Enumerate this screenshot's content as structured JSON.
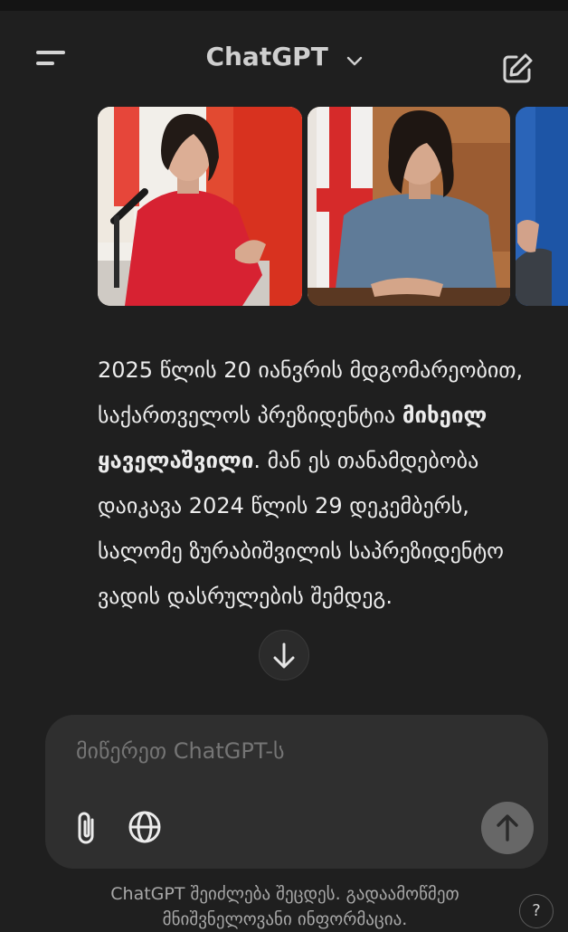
{
  "header": {
    "title": "ChatGPT",
    "menu_icon": "menu-icon",
    "model_chevron_icon": "chevron-down-icon",
    "new_chat_icon": "edit-icon"
  },
  "gallery": {
    "images": [
      {
        "subject": "woman in red jacket speaking at microphone in front of flags"
      },
      {
        "subject": "woman in blue-gray jacket seated at desk in front of flags"
      },
      {
        "subject": "partially visible person in front of flag"
      }
    ]
  },
  "message": {
    "part1": "2025 წლის 20 იანვრის მდგომარეობით, საქართველოს პრეზიდენტია ",
    "bold_name": "მიხეილ ყაველაშვილი",
    "part2": ". მან ეს თანამდებობა დაიკავა 2024 წლის 29 დეკემბერს, სალომე ზურაბიშვილის საპრეზიდენტო ვადის დასრულების შემდეგ."
  },
  "composer": {
    "placeholder": "მიწერეთ ChatGPT-ს",
    "attach_icon": "paperclip-icon",
    "web_icon": "globe-icon",
    "send_icon": "arrow-up-icon"
  },
  "scroll_icon": "arrow-down-icon",
  "footer": {
    "disclaimer": "ChatGPT შეიძლება შეცდეს. გადაამოწმეთ მნიშვნელოვანი ინფორმაცია.",
    "help_label": "?"
  },
  "colors": {
    "background": "#1f1f1f",
    "composer": "#2f2f2f",
    "send_button": "#676767"
  }
}
